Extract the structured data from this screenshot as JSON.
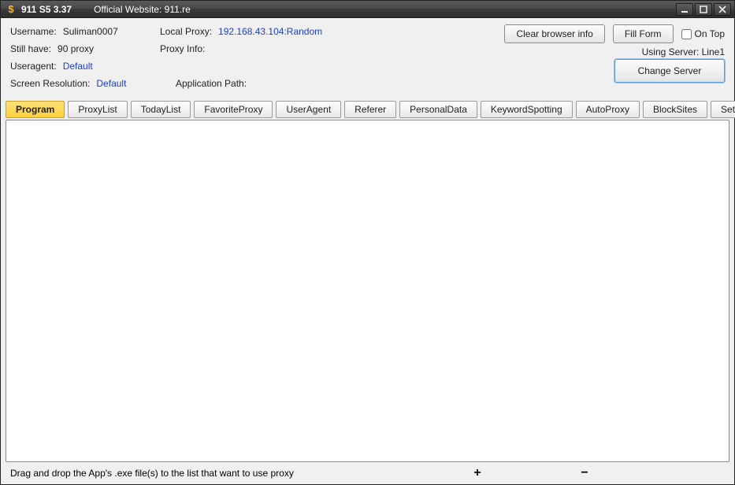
{
  "titlebar": {
    "icon_char": "$",
    "app_name": "911 S5 3.37",
    "website_label": "Official Website:  911.re"
  },
  "info": {
    "username_label": "Username:",
    "username_value": "Suliman0007",
    "stillhave_label": "Still have:",
    "stillhave_value": "90  proxy",
    "useragent_label": "Useragent:",
    "useragent_value": "Default",
    "screenres_label": "Screen Resolution:",
    "screenres_value": "Default",
    "localproxy_label": "Local Proxy:",
    "localproxy_value": "192.168.43.104:Random",
    "proxyinfo_label": "Proxy Info:",
    "apppath_label": "Application Path:"
  },
  "buttons": {
    "clear": "Clear browser info",
    "fill": "Fill Form",
    "ontop": "On Top",
    "change_server": "Change Server"
  },
  "server": {
    "label": "Using Server: Line1"
  },
  "tabs": [
    {
      "label": "Program"
    },
    {
      "label": "ProxyList"
    },
    {
      "label": "TodayList"
    },
    {
      "label": "FavoriteProxy"
    },
    {
      "label": "UserAgent"
    },
    {
      "label": "Referer"
    },
    {
      "label": "PersonalData"
    },
    {
      "label": "KeywordSpotting"
    },
    {
      "label": "AutoProxy"
    },
    {
      "label": "BlockSites"
    },
    {
      "label": "Settings"
    }
  ],
  "bottom": {
    "hint": "Drag and drop the App's .exe file(s) to the list that want to use proxy",
    "plus": "+",
    "minus": "−"
  }
}
